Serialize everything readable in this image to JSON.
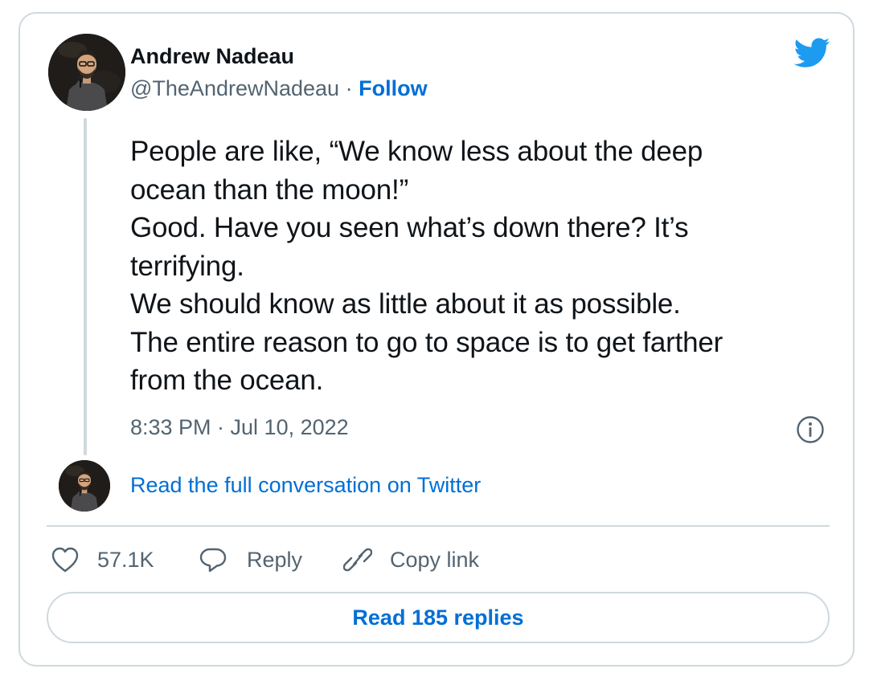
{
  "author": {
    "name": "Andrew Nadeau",
    "handle": "@TheAndrewNadeau",
    "separator": "·",
    "follow_label": "Follow"
  },
  "tweet": {
    "lines": [
      "People are like, “We know less about the deep",
      "ocean than the moon!”",
      "Good. Have you seen what’s down there? It’s",
      "terrifying.",
      "We should know as little about it as possible.",
      "The entire reason to go to space is to get farther",
      "from the ocean."
    ],
    "timestamp": "8:33 PM · Jul 10, 2022"
  },
  "conversation_link": "Read the full conversation on Twitter",
  "actions": {
    "like_count": "57.1K",
    "reply_label": "Reply",
    "copy_link_label": "Copy link"
  },
  "read_replies_label": "Read 185 replies",
  "colors": {
    "accent": "#006fd6",
    "twitter_blue": "#1d9bf0",
    "muted_text": "#536471",
    "border": "#cfd9de",
    "text": "#0f1419"
  },
  "icons": [
    "twitter-bird-icon",
    "info-icon",
    "heart-icon",
    "reply-bubble-icon",
    "link-icon"
  ]
}
